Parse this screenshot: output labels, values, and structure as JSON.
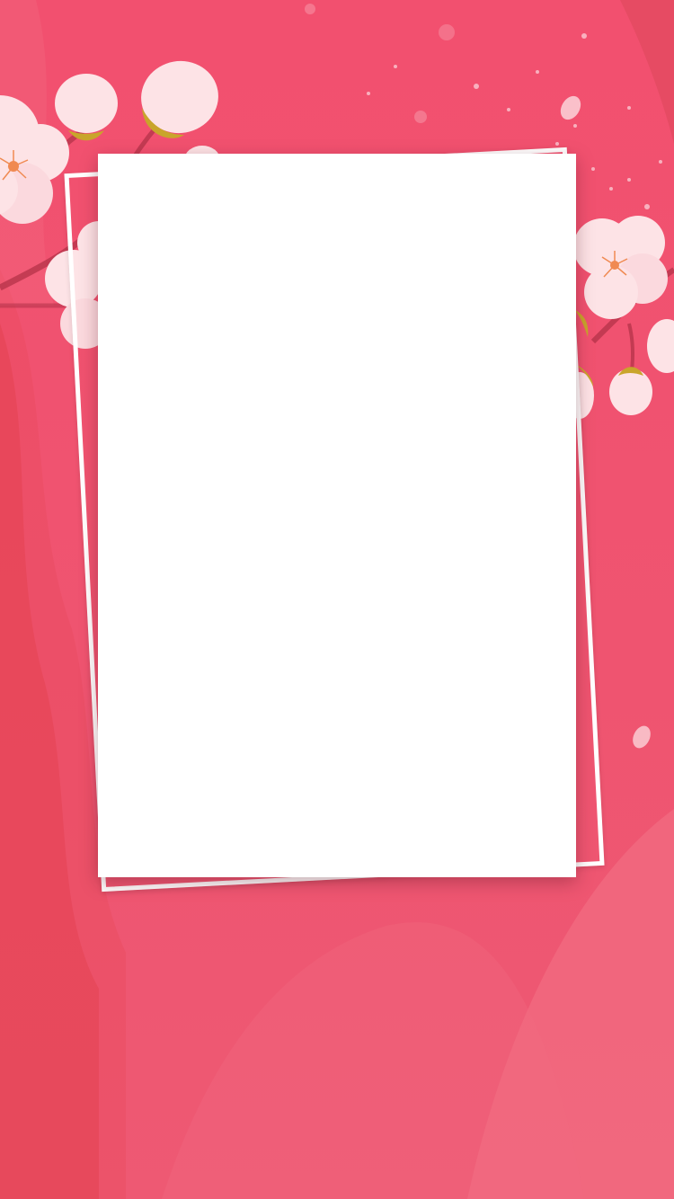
{
  "theme": {
    "background": "#f0566f",
    "card": "#ffffff",
    "blossom": "#fde3e6",
    "blossom_center": "#f08a52",
    "leaf": "#c9a52b",
    "branch": "#b8344b"
  },
  "decorations": {
    "left_branch_icon": "blossom-branch-icon",
    "right_branch_icon": "blossom-branch-icon",
    "petal_icon": "petal-icon"
  }
}
